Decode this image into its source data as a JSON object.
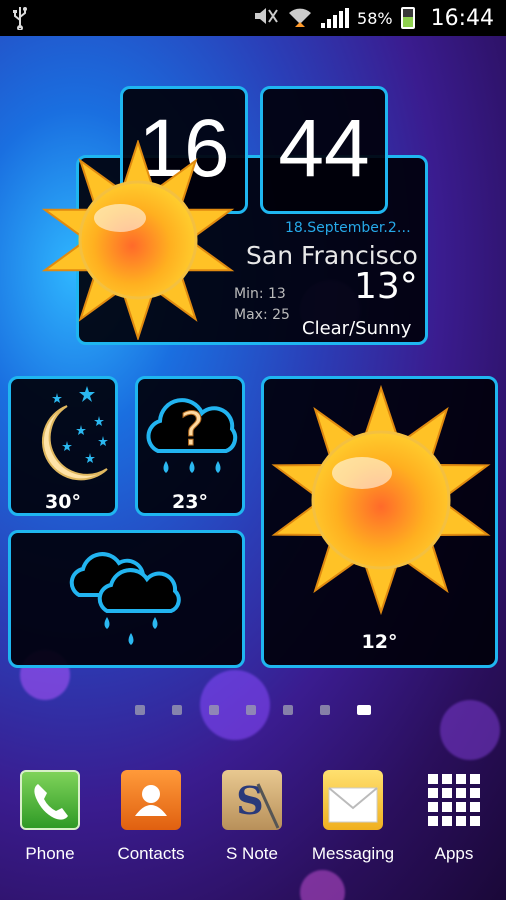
{
  "status_bar": {
    "battery_percent": "58%",
    "time": "16:44",
    "icons": [
      "usb-icon",
      "mute-icon",
      "wifi-icon",
      "signal-icon",
      "battery-charging-icon"
    ]
  },
  "clock_widget": {
    "hours": "16",
    "minutes": "44",
    "date": "18.September.2…",
    "city": "San Francisco",
    "temperature": "13°",
    "min": "Min: 13",
    "max": "Max: 25",
    "condition": "Clear/Sunny",
    "icon": "sun-icon"
  },
  "forecast_tiles": [
    {
      "icon": "moon-stars-icon",
      "temp": "30°"
    },
    {
      "icon": "unknown-weather-icon",
      "temp": "23°"
    },
    {
      "icon": "rain-clouds-icon",
      "temp": ""
    },
    {
      "icon": "sun-icon",
      "temp": "12°"
    }
  ],
  "page_indicator": {
    "count": 7,
    "active_index": 6
  },
  "dock": [
    {
      "label": "Phone",
      "icon": "phone-icon"
    },
    {
      "label": "Contacts",
      "icon": "contacts-icon"
    },
    {
      "label": "S Note",
      "icon": "snote-icon"
    },
    {
      "label": "Messaging",
      "icon": "messaging-icon"
    },
    {
      "label": "Apps",
      "icon": "apps-grid-icon"
    }
  ],
  "colors": {
    "accent": "#1fb6f0",
    "date_text": "#26a9e8"
  }
}
